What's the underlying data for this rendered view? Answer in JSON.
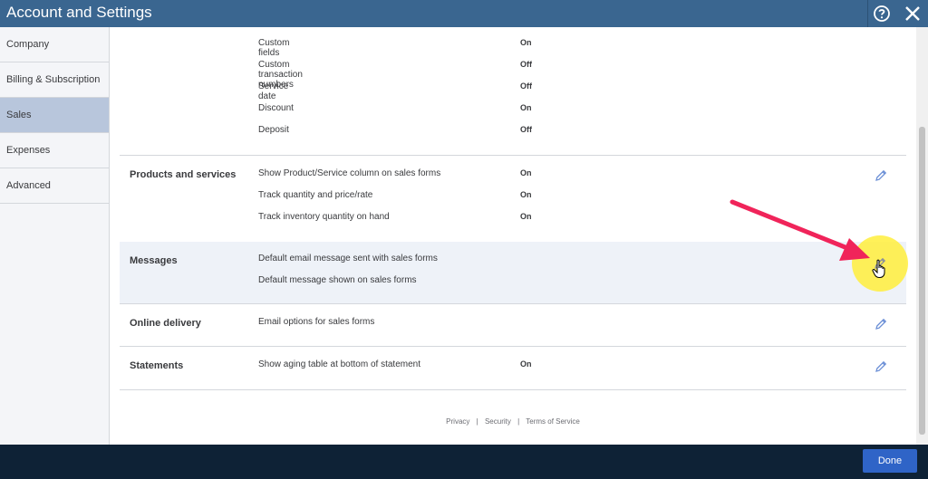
{
  "window": {
    "title": "Account and Settings",
    "help_icon": "help-circle-icon",
    "close_icon": "close-icon"
  },
  "sidebar": {
    "items": [
      {
        "label": "Company",
        "active": false
      },
      {
        "label": "Billing & Subscription",
        "active": false
      },
      {
        "label": "Sales",
        "active": true
      },
      {
        "label": "Expenses",
        "active": false
      },
      {
        "label": "Advanced",
        "active": false
      }
    ]
  },
  "form_content": {
    "rows": [
      {
        "label": "Custom fields",
        "value": "On"
      },
      {
        "label": "Custom transaction numbers",
        "value": "Off"
      },
      {
        "label": "Service date",
        "value": "Off"
      },
      {
        "label": "Discount",
        "value": "On"
      },
      {
        "label": "Deposit",
        "value": "Off"
      }
    ]
  },
  "sections": [
    {
      "title": "Products and services",
      "rows": [
        {
          "label": "Show Product/Service column on sales forms",
          "value": "On"
        },
        {
          "label": "Track quantity and price/rate",
          "value": "On"
        },
        {
          "label": "Track inventory quantity on hand",
          "value": "On"
        }
      ]
    },
    {
      "title": "Messages",
      "rows": [
        {
          "label": "Default email message sent with sales forms",
          "value": ""
        },
        {
          "label": "Default message shown on sales forms",
          "value": ""
        }
      ]
    },
    {
      "title": "Online delivery",
      "rows": [
        {
          "label": "Email options for sales forms",
          "value": ""
        }
      ]
    },
    {
      "title": "Statements",
      "rows": [
        {
          "label": "Show aging table at bottom of statement",
          "value": "On"
        }
      ]
    }
  ],
  "footer": {
    "privacy": "Privacy",
    "security": "Security",
    "terms": "Terms of Service",
    "separator": "|"
  },
  "actions": {
    "done": "Done"
  },
  "colors": {
    "titlebar": "#3a6690",
    "sidebar_active": "#b8c6dc",
    "bottombar": "#0e2236",
    "done_button": "#2f64c7",
    "annotation_arrow": "#f0245a",
    "highlight": "#fff03c"
  }
}
